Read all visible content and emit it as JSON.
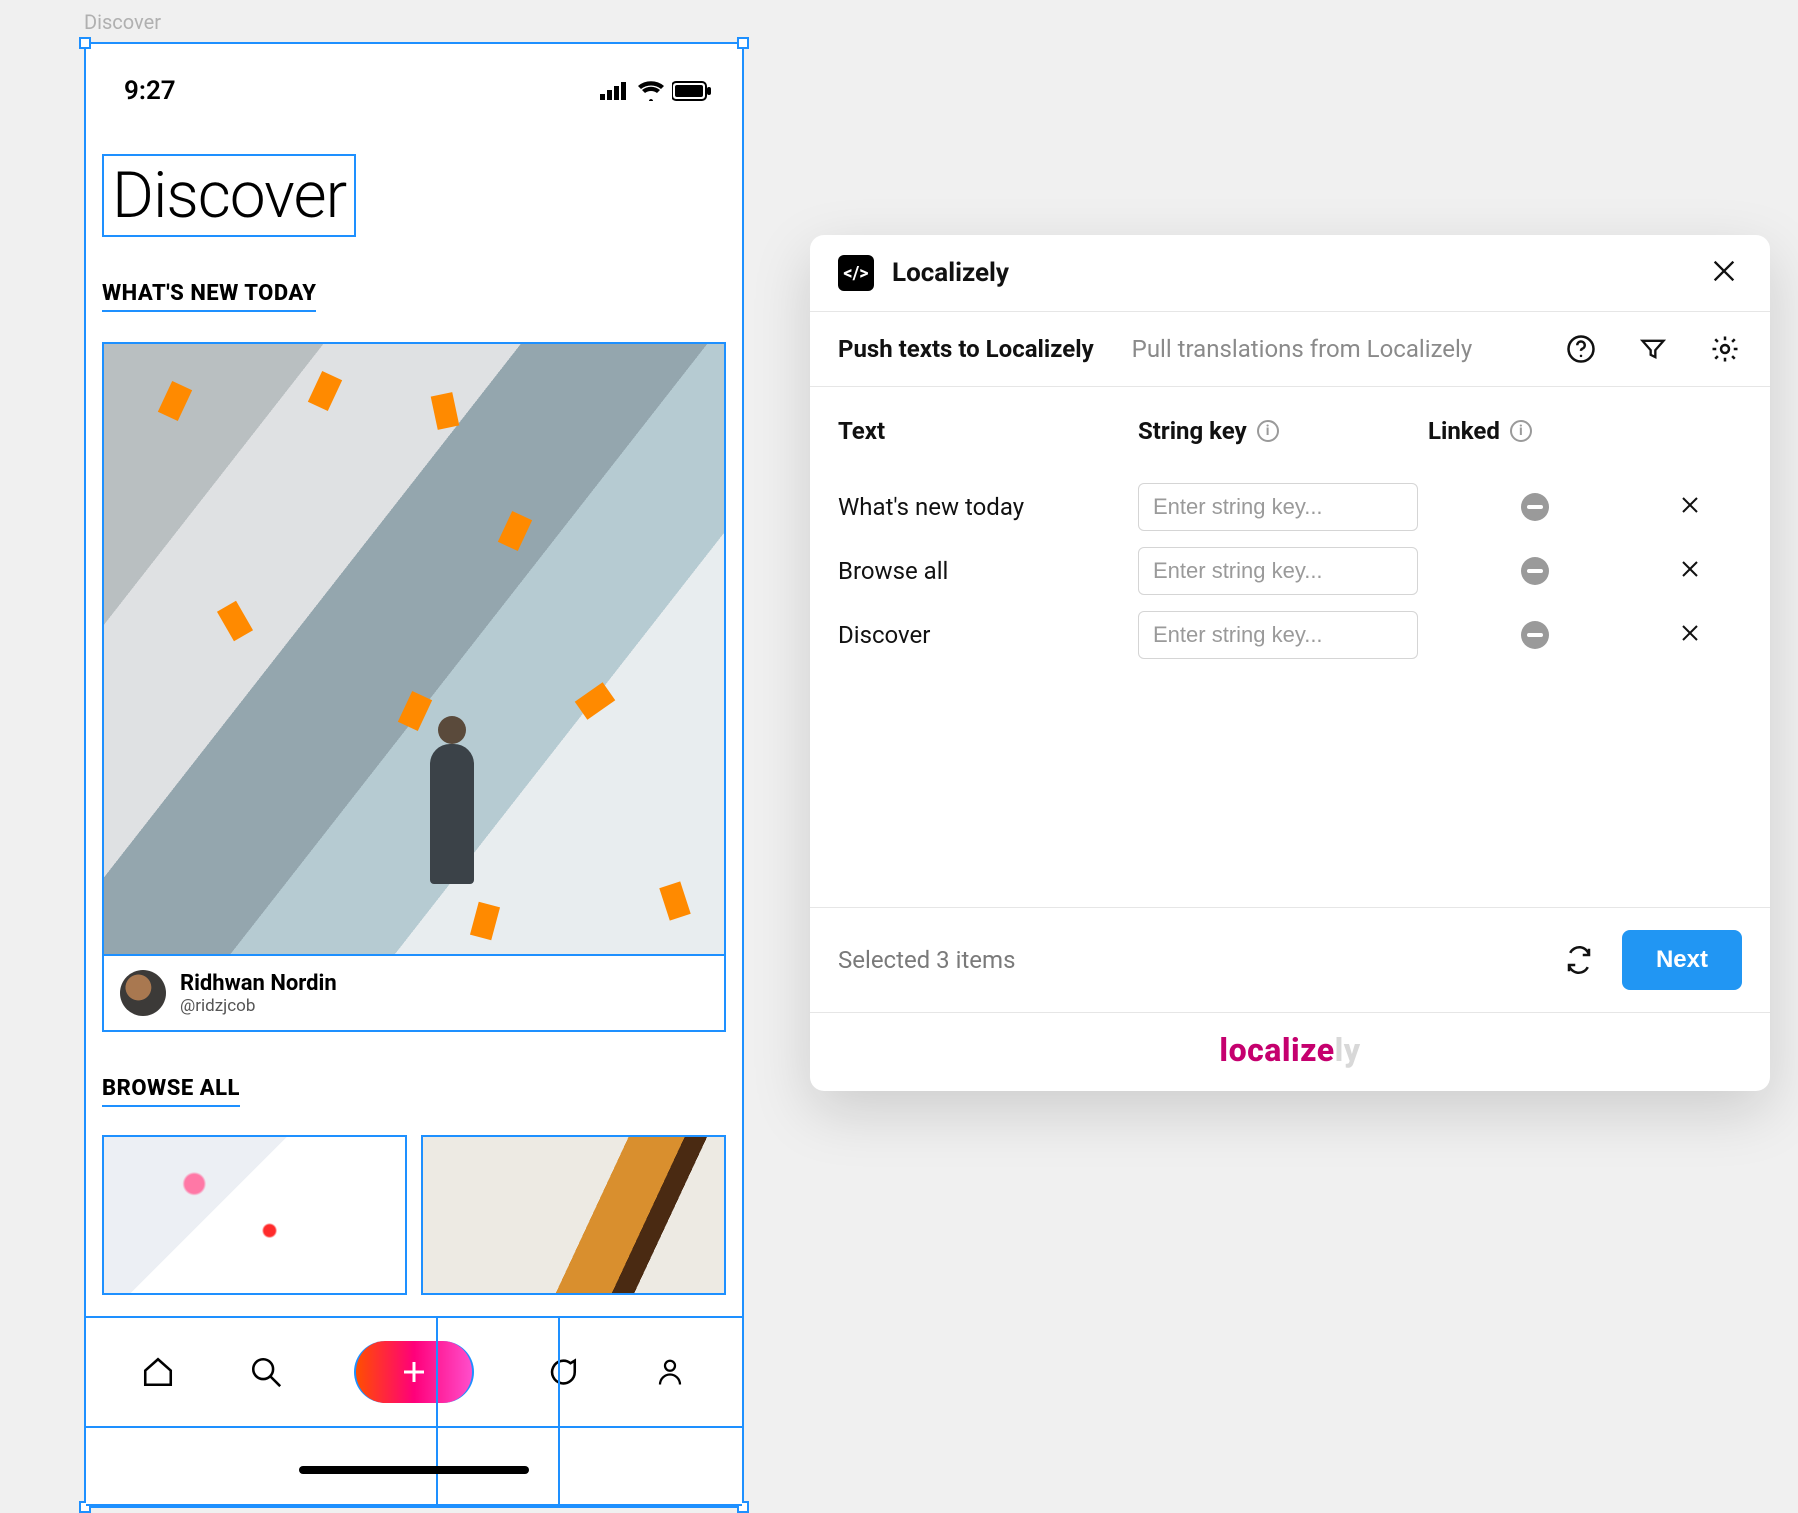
{
  "canvas": {
    "frame_label": "Discover"
  },
  "mobile": {
    "status_time": "9:27",
    "page_title": "Discover",
    "section_whats_new": "WHAT'S NEW TODAY",
    "card": {
      "author_name": "Ridhwan Nordin",
      "author_handle": "@ridzjcob"
    },
    "section_browse_all": "BROWSE ALL"
  },
  "dialog": {
    "brand": "Localizely",
    "tab_push": "Push texts to Localizely",
    "tab_pull": "Pull translations from Localizely",
    "columns": {
      "text": "Text",
      "key": "String key",
      "linked": "Linked"
    },
    "key_placeholder": "Enter string key...",
    "rows": [
      {
        "text": "What's new today"
      },
      {
        "text": "Browse all"
      },
      {
        "text": "Discover"
      }
    ],
    "footer_status": "Selected 3 items",
    "next_label": "Next",
    "logo_a": "localize",
    "logo_b": "ly"
  }
}
